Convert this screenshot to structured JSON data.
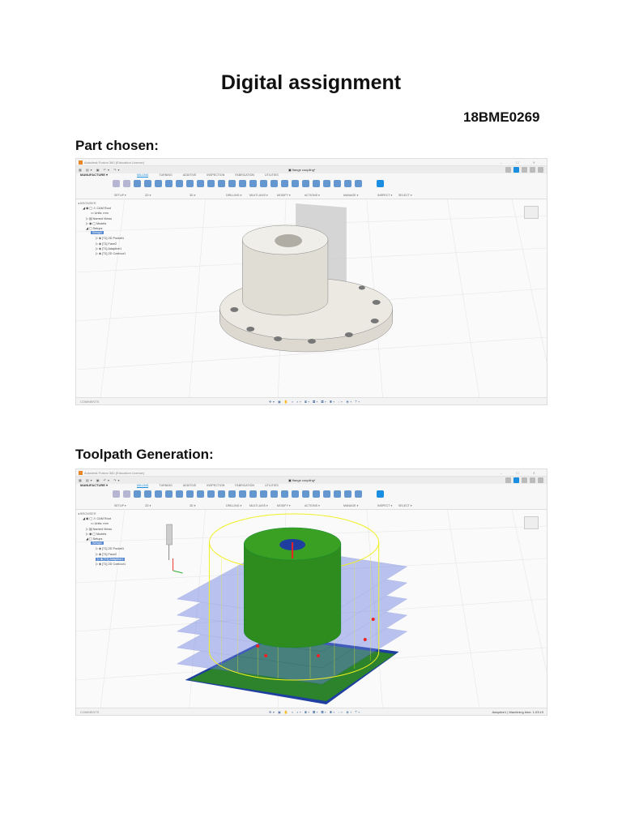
{
  "document": {
    "title": "Digital assignment",
    "reg_no": "18BME0269",
    "section1": "Part chosen:",
    "section2": "Toolpath Generation:"
  },
  "app": {
    "window_title": "Autodesk Fusion 360 (Education License)",
    "window_controls": "–  ☐  ✕",
    "quick_icons": "▦ ▤▾ ▣ ↶▾ ↷▾",
    "doc_tab": "▣ flange coupling*",
    "workspace": "MANUFACTURE ▾",
    "tabs": [
      "MILLING",
      "TURNING",
      "ADDITIVE",
      "INSPECTION",
      "FABRICATION",
      "UTILITIES"
    ],
    "groups": [
      "SETUP ▾",
      "2D ▾",
      "3D ▾",
      "DRILLING ▾",
      "MULTI-AXIS ▾",
      "MODIFY ▾",
      "ACTIONS ▾",
      "MANAGE ▾",
      "INSPECT ▾",
      "SELECT ▾"
    ],
    "browser": [
      "◂ BROWSER",
      "◢ ◉ ▢ ⚠ CAM Root",
      "▭ Units: mm",
      "▷ ▤ Named Views",
      "▷ ◉ ▢ Models",
      "◢ ▢ Setups"
    ],
    "setup": "Setup1",
    "operations": [
      "▷ ◈ [T1] 2D Pocket1",
      "▷ ◈ [T1] Face2",
      "▷ ◈ [T1] Adaptive1",
      "▷ ◈ [T1] 2D Contour1"
    ],
    "comments": "COMMENTS",
    "nav_bar": "✥▾ ▣ ✋ ⌕ ⌕▾ ▣▾ ▦▾ ▦▾ ◉▾ ◌▾ ◈▾ ⊤▾",
    "status": "Adaptive1 | Machining time: 1:03:19"
  },
  "colors": {
    "accent": "#1a8ee0",
    "stock": "#1f3fa0",
    "part": "#2e8b1e",
    "toolpath": "#f0f020"
  }
}
